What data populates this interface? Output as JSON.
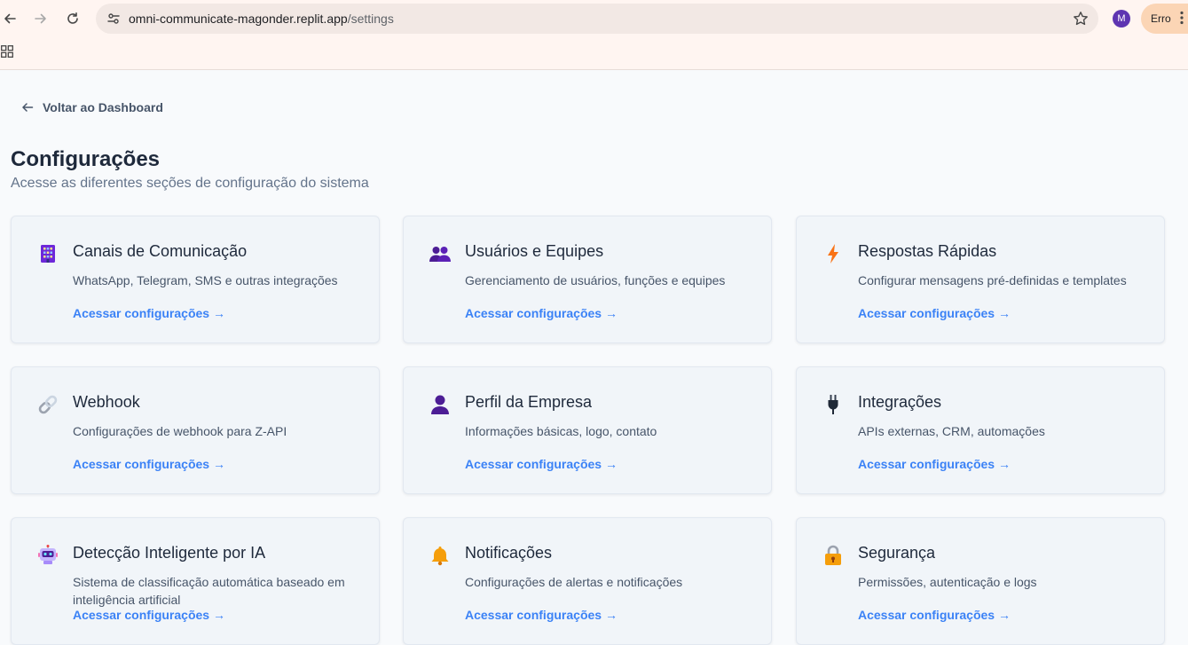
{
  "browser": {
    "url_host": "omni-communicate-magonder.replit.app",
    "url_path": "/settings",
    "profile_initial": "M",
    "error_label": "Erro"
  },
  "page": {
    "back_link": "Voltar ao Dashboard",
    "title": "Configurações",
    "subtitle": "Acesse as diferentes seções de configuração do sistema"
  },
  "cards": [
    {
      "icon": "building-icon",
      "title": "Canais de Comunicação",
      "description": "WhatsApp, Telegram, SMS e outras integrações",
      "link": "Acessar configurações →"
    },
    {
      "icon": "people-icon",
      "title": "Usuários e Equipes",
      "description": "Gerenciamento de usuários, funções e equipes",
      "link": "Acessar configurações →"
    },
    {
      "icon": "lightning-icon",
      "title": "Respostas Rápidas",
      "description": "Configurar mensagens pré-definidas e templates",
      "link": "Acessar configurações →"
    },
    {
      "icon": "link-icon",
      "title": "Webhook",
      "description": "Configurações de webhook para Z-API",
      "link": "Acessar configurações →"
    },
    {
      "icon": "person-icon",
      "title": "Perfil da Empresa",
      "description": "Informações básicas, logo, contato",
      "link": "Acessar configurações →"
    },
    {
      "icon": "plug-icon",
      "title": "Integrações",
      "description": "APIs externas, CRM, automações",
      "link": "Acessar configurações →"
    },
    {
      "icon": "robot-icon",
      "title": "Detecção Inteligente por IA",
      "description": "Sistema de classificação automática baseado em inteligência artificial",
      "link": "Acessar configurações →"
    },
    {
      "icon": "bell-icon",
      "title": "Notificações",
      "description": "Configurações de alertas e notificações",
      "link": "Acessar configurações →"
    },
    {
      "icon": "lock-icon",
      "title": "Segurança",
      "description": "Permissões, autenticação e logs",
      "link": "Acessar configurações →"
    }
  ]
}
